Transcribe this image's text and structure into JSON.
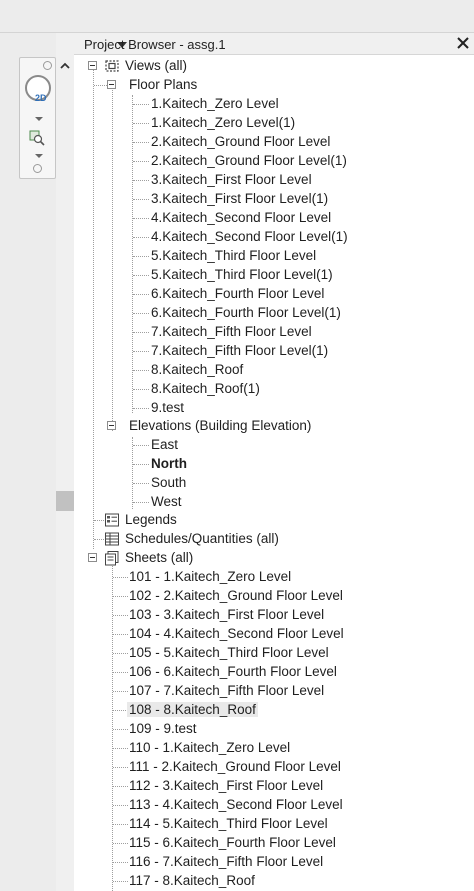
{
  "header": {
    "title": "Project Browser - assg.1"
  },
  "tree": {
    "views": {
      "label": "Views (all)",
      "floor_plans": {
        "label": "Floor Plans",
        "items": [
          "1.Kaitech_Zero Level",
          "1.Kaitech_Zero Level(1)",
          "2.Kaitech_Ground Floor Level",
          "2.Kaitech_Ground Floor Level(1)",
          "3.Kaitech_First Floor Level",
          "3.Kaitech_First Floor Level(1)",
          "4.Kaitech_Second Floor Level",
          "4.Kaitech_Second Floor Level(1)",
          "5.Kaitech_Third Floor Level",
          "5.Kaitech_Third Floor Level(1)",
          "6.Kaitech_Fourth Floor Level",
          "6.Kaitech_Fourth Floor Level(1)",
          "7.Kaitech_Fifth Floor Level",
          "7.Kaitech_Fifth Floor Level(1)",
          "8.Kaitech_Roof",
          "8.Kaitech_Roof(1)",
          "9.test"
        ]
      },
      "elevations": {
        "label": "Elevations (Building Elevation)",
        "items": [
          "East",
          "North",
          "South",
          "West"
        ],
        "active": "North"
      }
    },
    "legends": {
      "label": "Legends"
    },
    "schedules": {
      "label": "Schedules/Quantities (all)"
    },
    "sheets": {
      "label": "Sheets (all)",
      "items": [
        "101 - 1.Kaitech_Zero Level",
        "102 - 2.Kaitech_Ground Floor Level",
        "103 - 3.Kaitech_First Floor Level",
        "104 - 4.Kaitech_Second Floor Level",
        "105 - 5.Kaitech_Third Floor Level",
        "106 - 6.Kaitech_Fourth Floor Level",
        "107 - 7.Kaitech_Fifth Floor Level",
        "108 - 8.Kaitech_Roof",
        "109 - 9.test",
        "110 - 1.Kaitech_Zero Level",
        "111 - 2.Kaitech_Ground Floor Level",
        "112 - 3.Kaitech_First Floor Level",
        "113 - 4.Kaitech_Second Floor Level",
        "114 - 5.Kaitech_Third Floor Level",
        "115 - 6.Kaitech_Fourth Floor Level",
        "116 - 7.Kaitech_Fifth Floor Level",
        "117 - 8.Kaitech_Roof"
      ],
      "selected": "108 - 8.Kaitech_Roof"
    }
  },
  "nav_bar": {
    "wheel_label": "2D"
  },
  "colors": {
    "panel_bg": "#f0f0f0",
    "tree_bg": "#ffffff",
    "selection": "#e9e9e9",
    "accent_blue": "#2f6fb8"
  },
  "icons": {
    "views": "views-icon",
    "legends": "legends-icon",
    "schedules": "schedules-icon",
    "sheets": "sheets-icon"
  }
}
